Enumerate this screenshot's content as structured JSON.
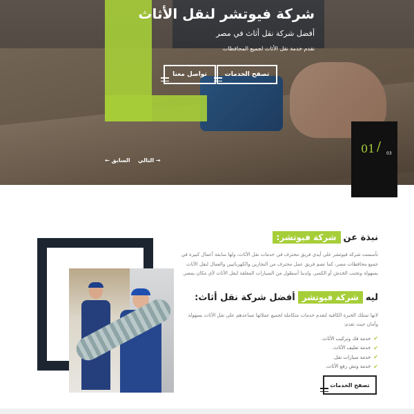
{
  "hero": {
    "title": "شركة فيوتشر لنقل الأثاث",
    "subtitle": "أفضل شركة نقل أثاث في مصر",
    "tagline": "نقدم خدمة نقل الأثاث لجميع المحافظات",
    "buttons": {
      "services": "تصفح الخدمات",
      "contact": "تواصل معنا"
    },
    "nav": {
      "next": "التالي →",
      "prev": "← السابق"
    },
    "slider": {
      "current": "01",
      "total": "03"
    }
  },
  "about": {
    "heading_prefix": "نبذة عن",
    "heading_highlight": "شركة فيوتشر:",
    "paragraph": "تأسست شركة فيوتشر على أيدي فريق محترف في خدمات نقل الأثاث، ولها سابقة أعمال كبيرة في جميع محافظات مصر، كما تضم فريق عمل محترف من النجارين والكهربائيين والعمال لنقل الأثاث بسهولة وتجنب الخدش أو الكسر، ولدينا أسطول من السيارات المغلقة لنقل الأثاث لأي مكان بمصر.",
    "why_prefix": "ليه",
    "why_highlight": "شركة فيوتشر",
    "why_suffix": "أفضل شركة نقل أثاث:",
    "why_paragraph": "لانها تمتلك الخبرة الكافية لتقدم خدمات متكاملة لجميع عملائها تساعدهم على نقل الأثاث بسهولة وأمان حيث تقدم:",
    "features": [
      "خدمة فك وتركيب الأثاث.",
      "خدمة تغليف الأثاث.",
      "خدمة سيارات نقل.",
      "خدمة ونش رفع الأثاث."
    ],
    "button": "تصفح الخدمات"
  },
  "colors": {
    "accent": "#a6ce39",
    "dark": "#1c2530",
    "text": "#222222",
    "muted": "#777777"
  }
}
